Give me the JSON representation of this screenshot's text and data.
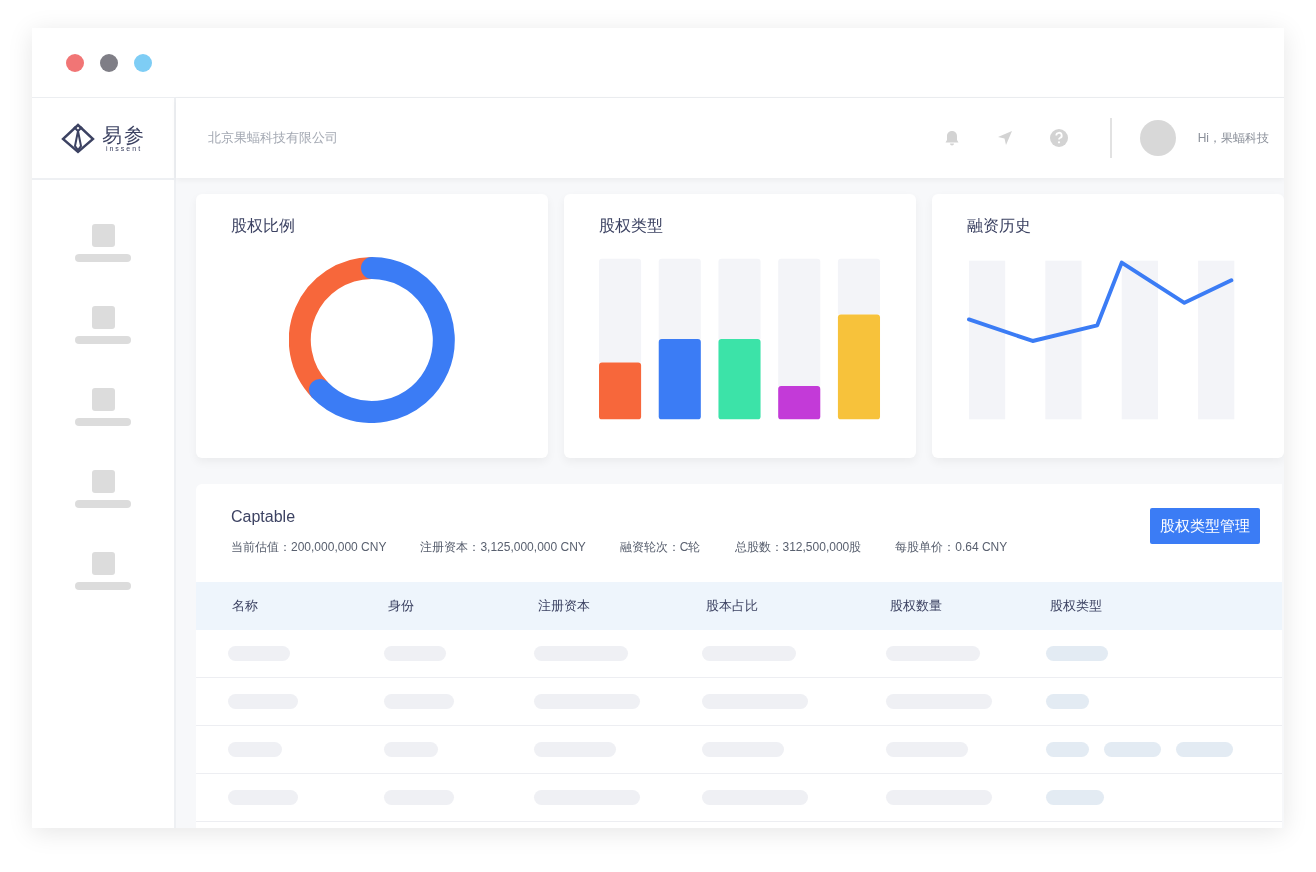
{
  "logo": {
    "name": "易参",
    "subtitle": "inssent"
  },
  "header": {
    "company": "北京果蝠科技有限公司",
    "greeting": "Hi，果蝠科技"
  },
  "cards": [
    {
      "title": "股权比例",
      "kind": "donut"
    },
    {
      "title": "股权类型",
      "kind": "bars"
    },
    {
      "title": "融资历史",
      "kind": "line"
    }
  ],
  "captable": {
    "title": "Captable",
    "button": "股权类型管理",
    "stats": [
      "当前估值：200,000,000 CNY",
      "注册资本：3,125,000,000 CNY",
      "融资轮次：C轮",
      "总股数：312,500,000股",
      "每股单价：0.64 CNY"
    ],
    "columns": [
      "名称",
      "身份",
      "注册资本",
      "股本占比",
      "股权数量",
      "股权类型"
    ]
  }
}
